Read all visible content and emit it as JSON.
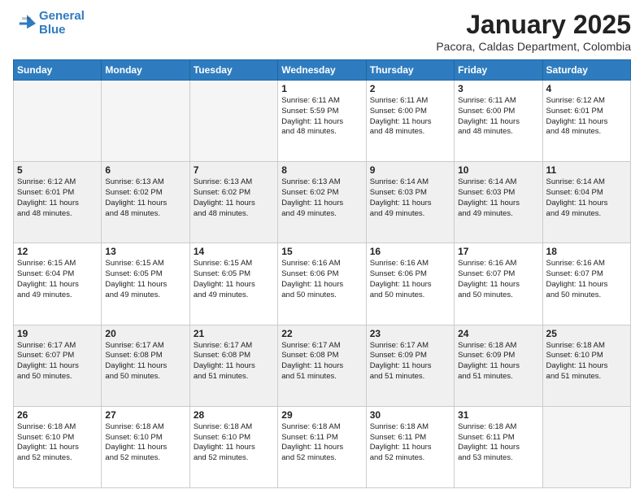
{
  "logo": {
    "line1": "General",
    "line2": "Blue"
  },
  "title": "January 2025",
  "subtitle": "Pacora, Caldas Department, Colombia",
  "days_header": [
    "Sunday",
    "Monday",
    "Tuesday",
    "Wednesday",
    "Thursday",
    "Friday",
    "Saturday"
  ],
  "weeks": [
    {
      "shaded": false,
      "days": [
        {
          "num": "",
          "info": ""
        },
        {
          "num": "",
          "info": ""
        },
        {
          "num": "",
          "info": ""
        },
        {
          "num": "1",
          "info": "Sunrise: 6:11 AM\nSunset: 5:59 PM\nDaylight: 11 hours\nand 48 minutes."
        },
        {
          "num": "2",
          "info": "Sunrise: 6:11 AM\nSunset: 6:00 PM\nDaylight: 11 hours\nand 48 minutes."
        },
        {
          "num": "3",
          "info": "Sunrise: 6:11 AM\nSunset: 6:00 PM\nDaylight: 11 hours\nand 48 minutes."
        },
        {
          "num": "4",
          "info": "Sunrise: 6:12 AM\nSunset: 6:01 PM\nDaylight: 11 hours\nand 48 minutes."
        }
      ]
    },
    {
      "shaded": true,
      "days": [
        {
          "num": "5",
          "info": "Sunrise: 6:12 AM\nSunset: 6:01 PM\nDaylight: 11 hours\nand 48 minutes."
        },
        {
          "num": "6",
          "info": "Sunrise: 6:13 AM\nSunset: 6:02 PM\nDaylight: 11 hours\nand 48 minutes."
        },
        {
          "num": "7",
          "info": "Sunrise: 6:13 AM\nSunset: 6:02 PM\nDaylight: 11 hours\nand 48 minutes."
        },
        {
          "num": "8",
          "info": "Sunrise: 6:13 AM\nSunset: 6:02 PM\nDaylight: 11 hours\nand 49 minutes."
        },
        {
          "num": "9",
          "info": "Sunrise: 6:14 AM\nSunset: 6:03 PM\nDaylight: 11 hours\nand 49 minutes."
        },
        {
          "num": "10",
          "info": "Sunrise: 6:14 AM\nSunset: 6:03 PM\nDaylight: 11 hours\nand 49 minutes."
        },
        {
          "num": "11",
          "info": "Sunrise: 6:14 AM\nSunset: 6:04 PM\nDaylight: 11 hours\nand 49 minutes."
        }
      ]
    },
    {
      "shaded": false,
      "days": [
        {
          "num": "12",
          "info": "Sunrise: 6:15 AM\nSunset: 6:04 PM\nDaylight: 11 hours\nand 49 minutes."
        },
        {
          "num": "13",
          "info": "Sunrise: 6:15 AM\nSunset: 6:05 PM\nDaylight: 11 hours\nand 49 minutes."
        },
        {
          "num": "14",
          "info": "Sunrise: 6:15 AM\nSunset: 6:05 PM\nDaylight: 11 hours\nand 49 minutes."
        },
        {
          "num": "15",
          "info": "Sunrise: 6:16 AM\nSunset: 6:06 PM\nDaylight: 11 hours\nand 50 minutes."
        },
        {
          "num": "16",
          "info": "Sunrise: 6:16 AM\nSunset: 6:06 PM\nDaylight: 11 hours\nand 50 minutes."
        },
        {
          "num": "17",
          "info": "Sunrise: 6:16 AM\nSunset: 6:07 PM\nDaylight: 11 hours\nand 50 minutes."
        },
        {
          "num": "18",
          "info": "Sunrise: 6:16 AM\nSunset: 6:07 PM\nDaylight: 11 hours\nand 50 minutes."
        }
      ]
    },
    {
      "shaded": true,
      "days": [
        {
          "num": "19",
          "info": "Sunrise: 6:17 AM\nSunset: 6:07 PM\nDaylight: 11 hours\nand 50 minutes."
        },
        {
          "num": "20",
          "info": "Sunrise: 6:17 AM\nSunset: 6:08 PM\nDaylight: 11 hours\nand 50 minutes."
        },
        {
          "num": "21",
          "info": "Sunrise: 6:17 AM\nSunset: 6:08 PM\nDaylight: 11 hours\nand 51 minutes."
        },
        {
          "num": "22",
          "info": "Sunrise: 6:17 AM\nSunset: 6:08 PM\nDaylight: 11 hours\nand 51 minutes."
        },
        {
          "num": "23",
          "info": "Sunrise: 6:17 AM\nSunset: 6:09 PM\nDaylight: 11 hours\nand 51 minutes."
        },
        {
          "num": "24",
          "info": "Sunrise: 6:18 AM\nSunset: 6:09 PM\nDaylight: 11 hours\nand 51 minutes."
        },
        {
          "num": "25",
          "info": "Sunrise: 6:18 AM\nSunset: 6:10 PM\nDaylight: 11 hours\nand 51 minutes."
        }
      ]
    },
    {
      "shaded": false,
      "days": [
        {
          "num": "26",
          "info": "Sunrise: 6:18 AM\nSunset: 6:10 PM\nDaylight: 11 hours\nand 52 minutes."
        },
        {
          "num": "27",
          "info": "Sunrise: 6:18 AM\nSunset: 6:10 PM\nDaylight: 11 hours\nand 52 minutes."
        },
        {
          "num": "28",
          "info": "Sunrise: 6:18 AM\nSunset: 6:10 PM\nDaylight: 11 hours\nand 52 minutes."
        },
        {
          "num": "29",
          "info": "Sunrise: 6:18 AM\nSunset: 6:11 PM\nDaylight: 11 hours\nand 52 minutes."
        },
        {
          "num": "30",
          "info": "Sunrise: 6:18 AM\nSunset: 6:11 PM\nDaylight: 11 hours\nand 52 minutes."
        },
        {
          "num": "31",
          "info": "Sunrise: 6:18 AM\nSunset: 6:11 PM\nDaylight: 11 hours\nand 53 minutes."
        },
        {
          "num": "",
          "info": ""
        }
      ]
    }
  ]
}
